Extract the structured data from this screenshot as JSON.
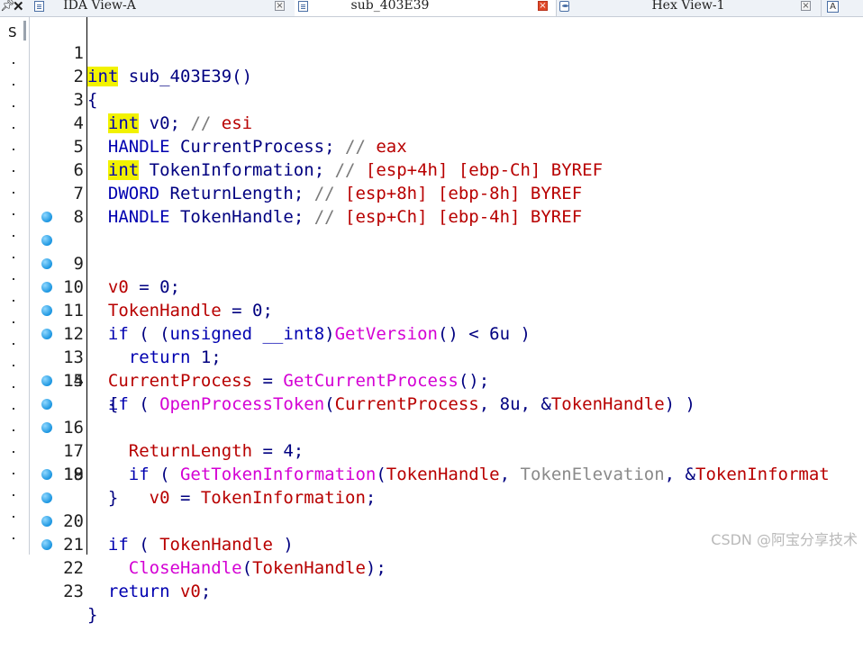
{
  "tabs": [
    {
      "label": "IDA View-A",
      "active": false
    },
    {
      "label": "sub_403E39",
      "active": true
    },
    {
      "label": "Hex View-1",
      "active": false
    }
  ],
  "side_panel": {
    "header": "S"
  },
  "code": {
    "lines": [
      {
        "num": "1",
        "bp": false
      },
      {
        "num": "2",
        "bp": false
      },
      {
        "num": "3",
        "bp": false
      },
      {
        "num": "4",
        "bp": false
      },
      {
        "num": "5",
        "bp": false
      },
      {
        "num": "6",
        "bp": false
      },
      {
        "num": "7",
        "bp": false
      },
      {
        "num": "8",
        "bp": false
      },
      {
        "num": "9",
        "bp": true
      },
      {
        "num": "10",
        "bp": true
      },
      {
        "num": "11",
        "bp": true
      },
      {
        "num": "12",
        "bp": true
      },
      {
        "num": "13",
        "bp": true
      },
      {
        "num": "14",
        "bp": true
      },
      {
        "num": "15",
        "bp": false
      },
      {
        "num": "16",
        "bp": true
      },
      {
        "num": "17",
        "bp": true
      },
      {
        "num": "18",
        "bp": true
      },
      {
        "num": "19",
        "bp": false
      },
      {
        "num": "20",
        "bp": true
      },
      {
        "num": "21",
        "bp": true
      },
      {
        "num": "22",
        "bp": true
      },
      {
        "num": "23",
        "bp": true
      }
    ],
    "text": {
      "l1_type": "int",
      "l1_name": " sub_403E39()",
      "l2": "{",
      "l3_type": "int",
      "l3_var": " v0",
      "l3_semi": ";",
      "l3_comment": " // ",
      "l3_reg": "esi",
      "l4_type": "HANDLE",
      "l4_var": " CurrentProcess",
      "l4_semi": ";",
      "l4_comment": " // ",
      "l4_reg": "eax",
      "l5_type": "int",
      "l5_var": " TokenInformation",
      "l5_semi": ";",
      "l5_comment": " // ",
      "l5_reg": "[esp+4h] [ebp-Ch] BYREF",
      "l6_type": "DWORD",
      "l6_var": " ReturnLength",
      "l6_semi": ";",
      "l6_comment": " // ",
      "l6_reg": "[esp+8h] [ebp-8h] BYREF",
      "l7_type": "HANDLE",
      "l7_var": " TokenHandle",
      "l7_semi": ";",
      "l7_comment": " // ",
      "l7_reg": "[esp+Ch] [ebp-4h] BYREF",
      "l9_var": "v0",
      "l9_rest": " = 0;",
      "l10_var": "TokenHandle",
      "l10_rest": " = 0;",
      "l11_if": "if",
      "l11_a": " ( (",
      "l11_unsigned": "unsigned __int8",
      "l11_b": ")",
      "l11_fn": "GetVersion",
      "l11_c": "() < 6u )",
      "l12_return": "return",
      "l12_rest": " 1;",
      "l13_var": "CurrentProcess",
      "l13_eq": " = ",
      "l13_fn": "GetCurrentProcess",
      "l13_rest": "();",
      "l14_if": "if",
      "l14_a": " ( ",
      "l14_fn": "OpenProcessToken",
      "l14_b": "(",
      "l14_arg1": "CurrentProcess",
      "l14_c": ", 8u, &",
      "l14_arg2": "TokenHandle",
      "l14_d": ") )",
      "l15": "{",
      "l16_var": "ReturnLength",
      "l16_rest": " = 4;",
      "l17_if": "if",
      "l17_a": " ( ",
      "l17_fn": "GetTokenInformation",
      "l17_b": "(",
      "l17_arg1": "TokenHandle",
      "l17_c": ", ",
      "l17_const": "TokenElevation",
      "l17_d": ", &",
      "l17_arg3": "TokenInformat",
      "l18_var": "v0",
      "l18_eq": " = ",
      "l18_var2": "TokenInformation",
      "l18_semi": ";",
      "l19": "}",
      "l20_if": "if",
      "l20_a": " ( ",
      "l20_var": "TokenHandle",
      "l20_b": " )",
      "l21_fn": "CloseHandle",
      "l21_a": "(",
      "l21_var": "TokenHandle",
      "l21_b": ");",
      "l22_return": "return",
      "l22_sp": " ",
      "l22_var": "v0",
      "l22_semi": ";",
      "l23": "}"
    }
  },
  "watermark": "CSDN @阿宝分享技术"
}
